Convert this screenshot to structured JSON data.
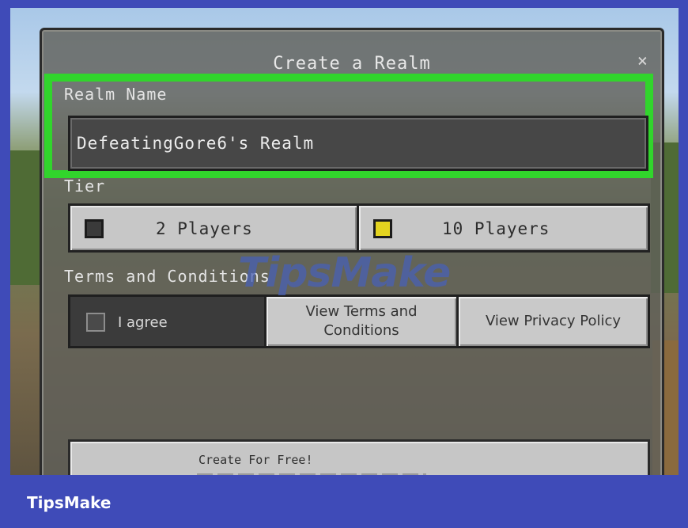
{
  "dialog": {
    "title": "Create a Realm",
    "close_label": "×"
  },
  "realm_name": {
    "label": "Realm Name",
    "value": "DefeatingGore6's Realm"
  },
  "tier": {
    "label": "Tier",
    "options": [
      {
        "label": "2 Players",
        "selected": false
      },
      {
        "label": "10 Players",
        "selected": true
      }
    ]
  },
  "terms": {
    "label": "Terms and Conditions",
    "agree_label": "I agree",
    "agree_checked": false,
    "view_terms_label": "View Terms and Conditions",
    "view_privacy_label": "View Privacy Policy"
  },
  "create_button": {
    "label": "Create For Free!"
  },
  "watermark": {
    "text": "TipsMake"
  },
  "brand": {
    "text": "TipsMake"
  },
  "colors": {
    "highlight": "#31d52c",
    "brand_bar": "#3f4bb8",
    "selected_box": "#e3d31f"
  }
}
